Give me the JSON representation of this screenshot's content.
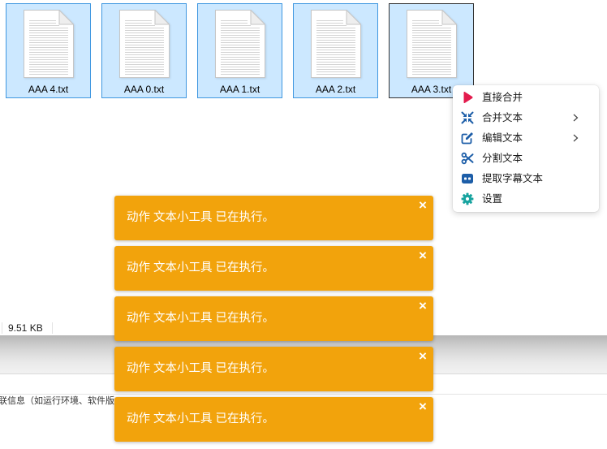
{
  "explorer": {
    "files": [
      {
        "name": "AAA 4.txt",
        "icon": "text-file-icon",
        "selected": true,
        "focused": false
      },
      {
        "name": "AAA 0.txt",
        "icon": "text-file-icon",
        "selected": true,
        "focused": false
      },
      {
        "name": "AAA 1.txt",
        "icon": "text-file-icon",
        "selected": true,
        "focused": false
      },
      {
        "name": "AAA 2.txt",
        "icon": "text-file-icon",
        "selected": true,
        "focused": false
      },
      {
        "name": "AAA 3.txt",
        "icon": "text-file-icon",
        "selected": true,
        "focused": true
      }
    ],
    "status_bar": {
      "selection_size": "9.51 KB"
    }
  },
  "context_menu": {
    "submenu_icon": "chevron-right-icon",
    "items": [
      {
        "label": "直接合并",
        "icon": "play-icon",
        "icon_color": "#e31b4d",
        "has_submenu": false
      },
      {
        "label": "合并文本",
        "icon": "compress-arrows-icon",
        "icon_color": "#1d5ea8",
        "has_submenu": true
      },
      {
        "label": "编辑文本",
        "icon": "edit-icon",
        "icon_color": "#1d5ea8",
        "has_submenu": true
      },
      {
        "label": "分割文本",
        "icon": "scissors-icon",
        "icon_color": "#1d5ea8",
        "has_submenu": false
      },
      {
        "label": "提取字幕文本",
        "icon": "subtitles-icon",
        "icon_color": "#1d5ea8",
        "has_submenu": false
      },
      {
        "label": "设置",
        "icon": "gear-icon",
        "icon_color": "#17a39f",
        "has_submenu": false
      }
    ]
  },
  "details_panel": {
    "text": "联信息（如运行环境、软件版"
  },
  "toasts": {
    "color": "#f2a30c",
    "close_label": "×",
    "items": [
      {
        "message": "动作 文本小工具 已在执行。"
      },
      {
        "message": "动作 文本小工具 已在执行。"
      },
      {
        "message": "动作 文本小工具 已在执行。"
      },
      {
        "message": "动作 文本小工具 已在执行。"
      },
      {
        "message": "动作 文本小工具 已在执行。"
      }
    ]
  },
  "colors": {
    "selection_bg": "#cce8ff",
    "selection_border": "#3f97e0",
    "focus_border": "#333333"
  }
}
